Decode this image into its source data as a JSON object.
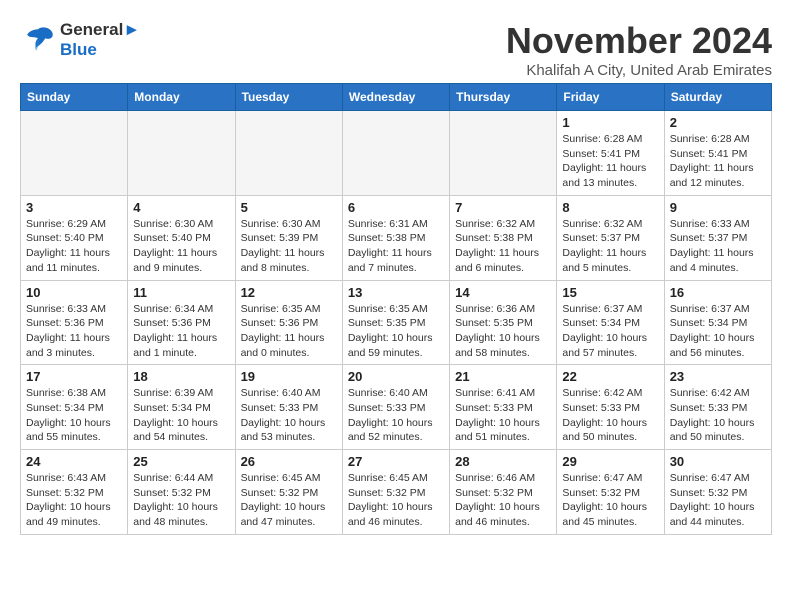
{
  "header": {
    "logo_line1": "General",
    "logo_line2": "Blue",
    "month": "November 2024",
    "location": "Khalifah A City, United Arab Emirates"
  },
  "weekdays": [
    "Sunday",
    "Monday",
    "Tuesday",
    "Wednesday",
    "Thursday",
    "Friday",
    "Saturday"
  ],
  "weeks": [
    [
      {
        "day": "",
        "info": ""
      },
      {
        "day": "",
        "info": ""
      },
      {
        "day": "",
        "info": ""
      },
      {
        "day": "",
        "info": ""
      },
      {
        "day": "",
        "info": ""
      },
      {
        "day": "1",
        "info": "Sunrise: 6:28 AM\nSunset: 5:41 PM\nDaylight: 11 hours\nand 13 minutes."
      },
      {
        "day": "2",
        "info": "Sunrise: 6:28 AM\nSunset: 5:41 PM\nDaylight: 11 hours\nand 12 minutes."
      }
    ],
    [
      {
        "day": "3",
        "info": "Sunrise: 6:29 AM\nSunset: 5:40 PM\nDaylight: 11 hours\nand 11 minutes."
      },
      {
        "day": "4",
        "info": "Sunrise: 6:30 AM\nSunset: 5:40 PM\nDaylight: 11 hours\nand 9 minutes."
      },
      {
        "day": "5",
        "info": "Sunrise: 6:30 AM\nSunset: 5:39 PM\nDaylight: 11 hours\nand 8 minutes."
      },
      {
        "day": "6",
        "info": "Sunrise: 6:31 AM\nSunset: 5:38 PM\nDaylight: 11 hours\nand 7 minutes."
      },
      {
        "day": "7",
        "info": "Sunrise: 6:32 AM\nSunset: 5:38 PM\nDaylight: 11 hours\nand 6 minutes."
      },
      {
        "day": "8",
        "info": "Sunrise: 6:32 AM\nSunset: 5:37 PM\nDaylight: 11 hours\nand 5 minutes."
      },
      {
        "day": "9",
        "info": "Sunrise: 6:33 AM\nSunset: 5:37 PM\nDaylight: 11 hours\nand 4 minutes."
      }
    ],
    [
      {
        "day": "10",
        "info": "Sunrise: 6:33 AM\nSunset: 5:36 PM\nDaylight: 11 hours\nand 3 minutes."
      },
      {
        "day": "11",
        "info": "Sunrise: 6:34 AM\nSunset: 5:36 PM\nDaylight: 11 hours\nand 1 minute."
      },
      {
        "day": "12",
        "info": "Sunrise: 6:35 AM\nSunset: 5:36 PM\nDaylight: 11 hours\nand 0 minutes."
      },
      {
        "day": "13",
        "info": "Sunrise: 6:35 AM\nSunset: 5:35 PM\nDaylight: 10 hours\nand 59 minutes."
      },
      {
        "day": "14",
        "info": "Sunrise: 6:36 AM\nSunset: 5:35 PM\nDaylight: 10 hours\nand 58 minutes."
      },
      {
        "day": "15",
        "info": "Sunrise: 6:37 AM\nSunset: 5:34 PM\nDaylight: 10 hours\nand 57 minutes."
      },
      {
        "day": "16",
        "info": "Sunrise: 6:37 AM\nSunset: 5:34 PM\nDaylight: 10 hours\nand 56 minutes."
      }
    ],
    [
      {
        "day": "17",
        "info": "Sunrise: 6:38 AM\nSunset: 5:34 PM\nDaylight: 10 hours\nand 55 minutes."
      },
      {
        "day": "18",
        "info": "Sunrise: 6:39 AM\nSunset: 5:34 PM\nDaylight: 10 hours\nand 54 minutes."
      },
      {
        "day": "19",
        "info": "Sunrise: 6:40 AM\nSunset: 5:33 PM\nDaylight: 10 hours\nand 53 minutes."
      },
      {
        "day": "20",
        "info": "Sunrise: 6:40 AM\nSunset: 5:33 PM\nDaylight: 10 hours\nand 52 minutes."
      },
      {
        "day": "21",
        "info": "Sunrise: 6:41 AM\nSunset: 5:33 PM\nDaylight: 10 hours\nand 51 minutes."
      },
      {
        "day": "22",
        "info": "Sunrise: 6:42 AM\nSunset: 5:33 PM\nDaylight: 10 hours\nand 50 minutes."
      },
      {
        "day": "23",
        "info": "Sunrise: 6:42 AM\nSunset: 5:33 PM\nDaylight: 10 hours\nand 50 minutes."
      }
    ],
    [
      {
        "day": "24",
        "info": "Sunrise: 6:43 AM\nSunset: 5:32 PM\nDaylight: 10 hours\nand 49 minutes."
      },
      {
        "day": "25",
        "info": "Sunrise: 6:44 AM\nSunset: 5:32 PM\nDaylight: 10 hours\nand 48 minutes."
      },
      {
        "day": "26",
        "info": "Sunrise: 6:45 AM\nSunset: 5:32 PM\nDaylight: 10 hours\nand 47 minutes."
      },
      {
        "day": "27",
        "info": "Sunrise: 6:45 AM\nSunset: 5:32 PM\nDaylight: 10 hours\nand 46 minutes."
      },
      {
        "day": "28",
        "info": "Sunrise: 6:46 AM\nSunset: 5:32 PM\nDaylight: 10 hours\nand 46 minutes."
      },
      {
        "day": "29",
        "info": "Sunrise: 6:47 AM\nSunset: 5:32 PM\nDaylight: 10 hours\nand 45 minutes."
      },
      {
        "day": "30",
        "info": "Sunrise: 6:47 AM\nSunset: 5:32 PM\nDaylight: 10 hours\nand 44 minutes."
      }
    ]
  ]
}
